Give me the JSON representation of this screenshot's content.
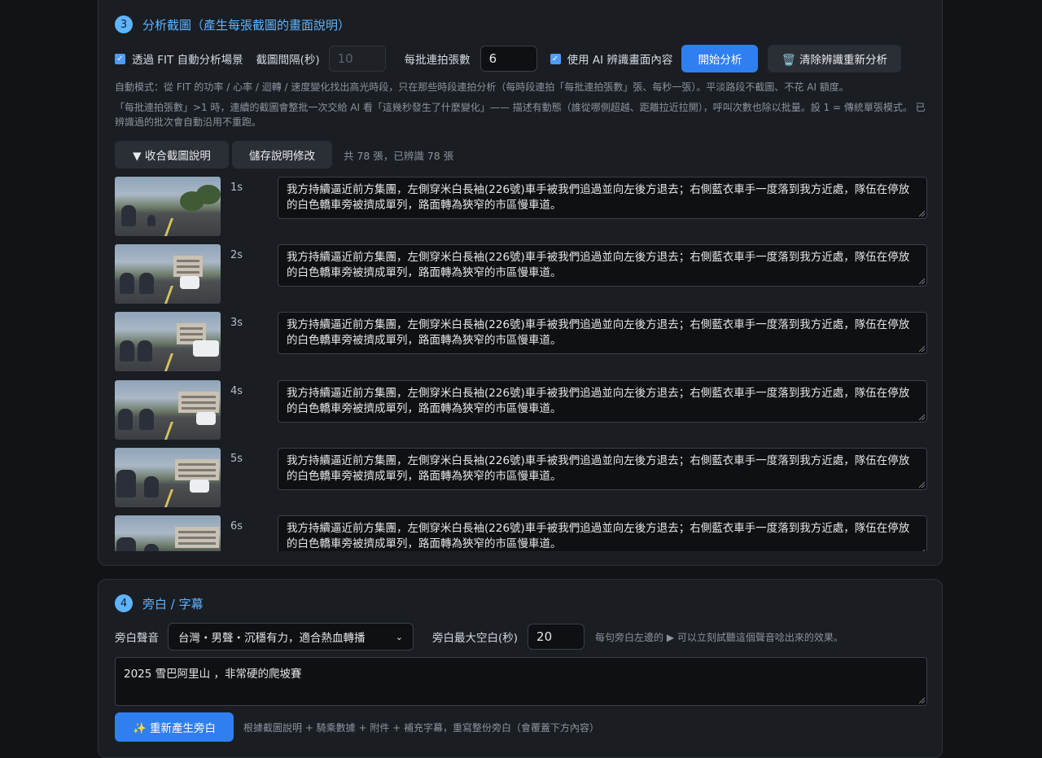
{
  "section3": {
    "step": "3",
    "title": "分析截圖（產生每張截圖的畫面說明）",
    "fit_checkbox_label": "透過 FIT 自動分析場景",
    "interval_label": "截圖間隔(秒)",
    "interval_value": "10",
    "batch_label": "每批連拍張數",
    "batch_value": "6",
    "ai_checkbox_label": "使用 AI 辨識畫面內容",
    "analyze_button": "開始分析",
    "clear_button": "🗑️ 清除辨識重新分析",
    "hint1": "自動模式：從 FIT 的功率 / 心率 / 迴轉 / 速度變化找出高光時段，只在那些時段連拍分析（每時段連拍「每批連拍張數」張、每秒一張）。平淡路段不截圖、不花 AI 額度。",
    "hint2": "「每批連拍張數」>1 時，連續的截圖會整批一次交給 AI 看「這幾秒發生了什麼變化」—— 描述有動態（誰從哪側超越、距離拉近拉開），呼叫次數也除以批量。設 1 = 傳統單張模式。 已辨識過的批次會自動沿用不重跑。",
    "collapse_button": "▼ 收合截圖說明",
    "save_button": "儲存說明修改",
    "count_text": "共 78 張，已辨識 78 張",
    "shots": [
      {
        "time": "1s",
        "description": "我方持續逼近前方集團，左側穿米白長袖(226號)車手被我們追過並向左後方退去；右側藍衣車手一度落到我方近處，隊伍在停放的白色轎車旁被擠成單列，路面轉為狹窄的市區慢車道。"
      },
      {
        "time": "2s",
        "description": "我方持續逼近前方集團，左側穿米白長袖(226號)車手被我們追過並向左後方退去；右側藍衣車手一度落到我方近處，隊伍在停放的白色轎車旁被擠成單列，路面轉為狹窄的市區慢車道。"
      },
      {
        "time": "3s",
        "description": "我方持續逼近前方集團，左側穿米白長袖(226號)車手被我們追過並向左後方退去；右側藍衣車手一度落到我方近處，隊伍在停放的白色轎車旁被擠成單列，路面轉為狹窄的市區慢車道。"
      },
      {
        "time": "4s",
        "description": "我方持續逼近前方集團，左側穿米白長袖(226號)車手被我們追過並向左後方退去；右側藍衣車手一度落到我方近處，隊伍在停放的白色轎車旁被擠成單列，路面轉為狹窄的市區慢車道。"
      },
      {
        "time": "5s",
        "description": "我方持續逼近前方集團，左側穿米白長袖(226號)車手被我們追過並向左後方退去；右側藍衣車手一度落到我方近處，隊伍在停放的白色轎車旁被擠成單列，路面轉為狹窄的市區慢車道。"
      },
      {
        "time": "6s",
        "description": "我方持續逼近前方集團，左側穿米白長袖(226號)車手被我們追過並向左後方退去；右側藍衣車手一度落到我方近處，隊伍在停放的白色轎車旁被擠成單列，路面轉為狹窄的市區慢車道。"
      }
    ]
  },
  "section4": {
    "step": "4",
    "title": "旁白 / 字幕",
    "voice_label": "旁白聲音",
    "voice_selected": "台灣・男聲・沉穩有力，適合熱血轉播",
    "max_gap_label": "旁白最大空白(秒)",
    "max_gap_value": "20",
    "voice_hint": "每句旁白左邊的 ▶ 可以立刻試聽這個聲音唸出來的效果。",
    "narration_text": "2025 雪巴阿里山 ，非常硬的爬坡賽",
    "regen_button": "✨ 重新產生旁白",
    "regen_hint": "根據截圖說明 + 騎乘數據 + 附件 + 補充字幕，重寫整份旁白（會覆蓋下方內容）"
  }
}
